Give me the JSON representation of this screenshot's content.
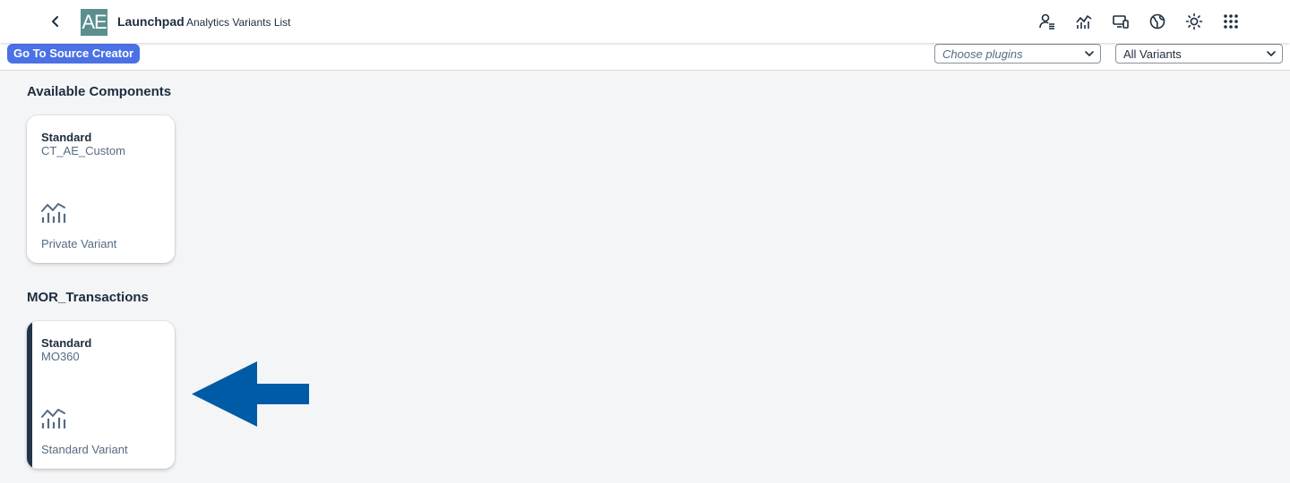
{
  "shell": {
    "logo_text": "AE",
    "title": "Launchpad",
    "subtitle": "Analytics Variants List",
    "actions": [
      "user-settings-icon",
      "analytics-icon",
      "devices-icon",
      "globe-icon",
      "theme-sun-icon",
      "app-grid-icon"
    ]
  },
  "toolbar": {
    "source_button": "Go To Source Creator",
    "plugins_placeholder": "Choose plugins",
    "variants_value": "All Variants"
  },
  "sections": [
    {
      "title": "Available Components",
      "tile": {
        "title": "Standard",
        "subtitle": "CT_AE_Custom",
        "footer": "Private Variant",
        "icon": "line-chart-icon"
      }
    },
    {
      "title": "MOR_Transactions",
      "tile": {
        "title": "Standard",
        "subtitle": "MO360",
        "footer": "Standard Variant",
        "icon": "line-chart-icon"
      }
    }
  ],
  "colors": {
    "accent": "#4b71e6",
    "logo": "#5b8f8f",
    "annotation_arrow": "#005ba6",
    "selected_marker": "#223548"
  }
}
